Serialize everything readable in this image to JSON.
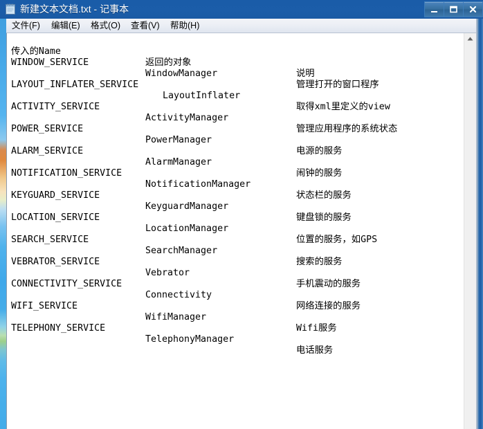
{
  "window": {
    "title": "新建文本文档.txt - 记事本",
    "icon": "notepad-icon",
    "titlebar_color": "#1a5ca8",
    "controls": {
      "minimize_label": "最小化",
      "maximize_label": "最大化",
      "close_label": "关闭"
    }
  },
  "menubar": {
    "items": [
      {
        "label": "文件(F)",
        "name": "menu-file"
      },
      {
        "label": "编辑(E)",
        "name": "menu-edit"
      },
      {
        "label": "格式(O)",
        "name": "menu-format"
      },
      {
        "label": "查看(V)",
        "name": "menu-view"
      },
      {
        "label": "帮助(H)",
        "name": "menu-help"
      }
    ]
  },
  "document": {
    "columns": {
      "name": "传入的Name",
      "object": "返回的对象",
      "description": "说明"
    },
    "rows": [
      {
        "name": "WINDOW_SERVICE",
        "object": "WindowManager",
        "description": "管理打开的窗口程序"
      },
      {
        "name": "LAYOUT_INFLATER_SERVICE",
        "object": "LayoutInflater",
        "description": "取得xml里定义的view"
      },
      {
        "name": "ACTIVITY_SERVICE",
        "object": "ActivityManager",
        "description": "管理应用程序的系统状态"
      },
      {
        "name": "POWER_SERVICE",
        "object": "PowerManager",
        "description": "电源的服务"
      },
      {
        "name": "ALARM_SERVICE",
        "object": "AlarmManager",
        "description": "闹钟的服务"
      },
      {
        "name": "NOTIFICATION_SERVICE",
        "object": "NotificationManager",
        "description": "状态栏的服务"
      },
      {
        "name": "KEYGUARD_SERVICE",
        "object": "KeyguardManager",
        "description": "键盘锁的服务"
      },
      {
        "name": "LOCATION_SERVICE",
        "object": "LocationManager",
        "description": "位置的服务，如GPS"
      },
      {
        "name": "SEARCH_SERVICE",
        "object": "SearchManager",
        "description": "搜索的服务"
      },
      {
        "name": "VEBRATOR_SERVICE",
        "object": "Vebrator",
        "description": "手机震动的服务"
      },
      {
        "name": "CONNECTIVITY_SERVICE",
        "object": "Connectivity",
        "description": "网络连接的服务"
      },
      {
        "name": "WIFI_SERVICE",
        "object": "WifiManager",
        "description": "Wifi服务"
      },
      {
        "name": "TELEPHONY_SERVICE",
        "object": "TelephonyManager",
        "description": "电话服务"
      }
    ]
  },
  "scrollbar": {
    "up_arrow": "scroll-up-icon",
    "orientation": "vertical"
  }
}
